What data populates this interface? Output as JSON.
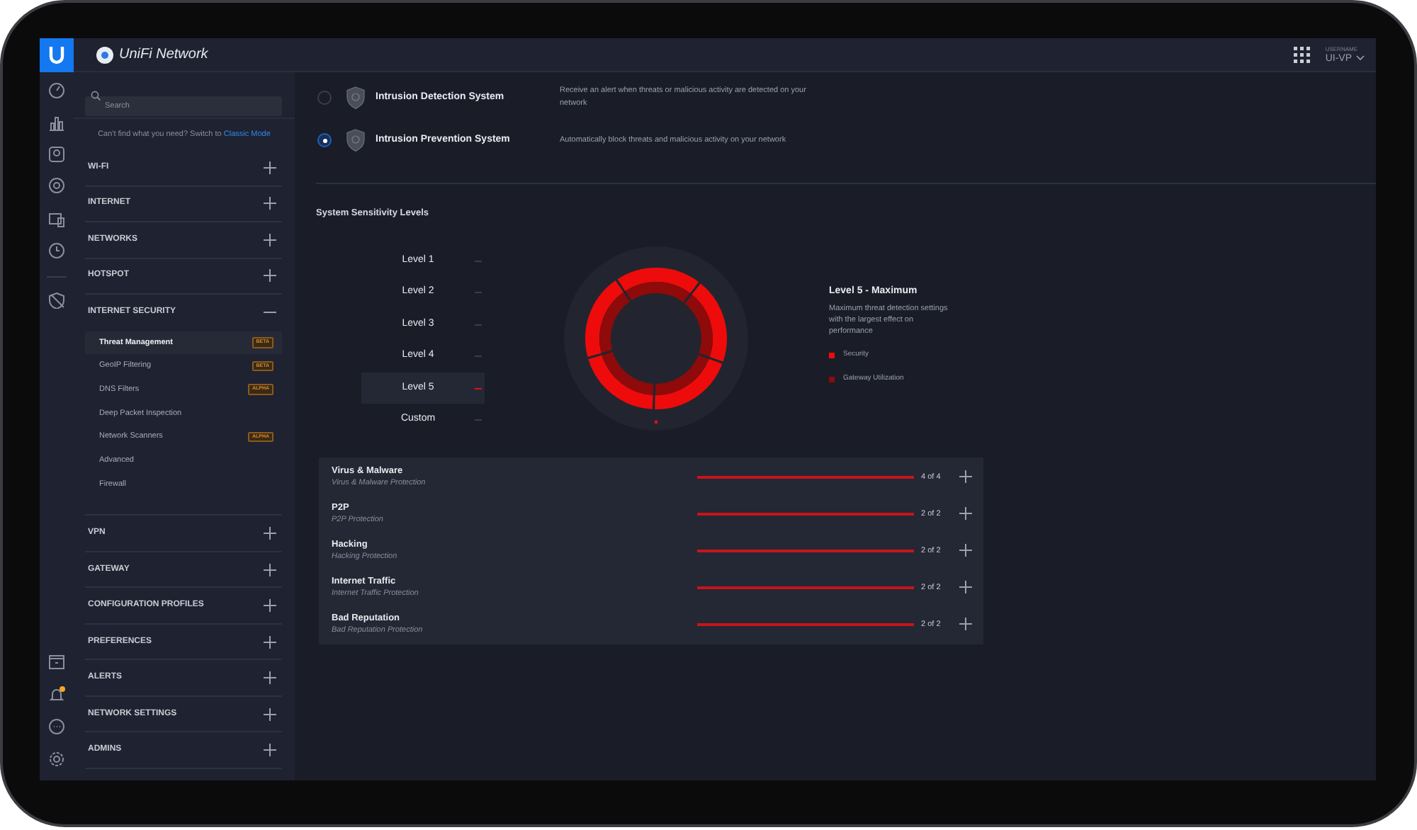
{
  "header": {
    "app_name": "UniFi Network",
    "user_label": "USERNAME",
    "user": "UI-VP"
  },
  "rail": {
    "notification": true
  },
  "sidebar": {
    "search": {
      "placeholder": "Search"
    },
    "hint": "Can't find what you need? Switch to",
    "hint_link": "Classic Mode",
    "sections": [
      {
        "label": "WI-FI",
        "expanded": false
      },
      {
        "label": "INTERNET",
        "expanded": false
      },
      {
        "label": "NETWORKS",
        "expanded": false
      },
      {
        "label": "HOTSPOT",
        "expanded": false
      },
      {
        "label": "INTERNET SECURITY",
        "expanded": true,
        "children": [
          {
            "label": "Threat Management",
            "selected": true,
            "badge": "BETA"
          },
          {
            "label": "GeoIP Filtering",
            "selected": false,
            "badge": "BETA"
          },
          {
            "label": "DNS Filters",
            "selected": false,
            "badge": "ALPHA"
          },
          {
            "label": "Deep Packet Inspection",
            "selected": false
          },
          {
            "label": "Network Scanners",
            "selected": false,
            "badge": "ALPHA"
          },
          {
            "label": "Advanced",
            "selected": false
          },
          {
            "label": "Firewall",
            "selected": false
          }
        ]
      },
      {
        "label": "VPN",
        "expanded": false
      },
      {
        "label": "GATEWAY",
        "expanded": false
      },
      {
        "label": "CONFIGURATION PROFILES",
        "expanded": false
      },
      {
        "label": "PREFERENCES",
        "expanded": false
      },
      {
        "label": "ALERTS",
        "expanded": false
      },
      {
        "label": "NETWORK SETTINGS",
        "expanded": false
      },
      {
        "label": "ADMINS",
        "expanded": false
      }
    ]
  },
  "systems": [
    {
      "label": "Intrusion Detection System",
      "description": "Receive an alert when threats or malicious activity are detected on your network",
      "selected": false
    },
    {
      "label": "Intrusion Prevention System",
      "description": "Automatically block threats and malicious activity on your network",
      "selected": true
    }
  ],
  "sensitivity": {
    "title": "System Sensitivity Levels",
    "levels": [
      {
        "label": "Level 1",
        "selected": false
      },
      {
        "label": "Level 2",
        "selected": false
      },
      {
        "label": "Level 3",
        "selected": false
      },
      {
        "label": "Level 4",
        "selected": false
      },
      {
        "label": "Level 5",
        "selected": true
      },
      {
        "label": "Custom",
        "selected": false
      }
    ],
    "detail_title": "Level 5 - Maximum",
    "detail_text": "Maximum threat detection settings with the largest effect on performance",
    "legend": [
      {
        "label": "Security",
        "color": "#ee0b0b"
      },
      {
        "label": "Gateway Utilization",
        "color": "#8f0a0a"
      }
    ]
  },
  "categories": [
    {
      "name": "Virus & Malware",
      "subtitle": "Virus & Malware Protection",
      "level": 1,
      "reading": "4 of 4"
    },
    {
      "name": "P2P",
      "subtitle": "P2P Protection",
      "level": 1,
      "reading": "2 of 2"
    },
    {
      "name": "Hacking",
      "subtitle": "Hacking Protection",
      "level": 1,
      "reading": "2 of 2"
    },
    {
      "name": "Internet Traffic",
      "subtitle": "Internet Traffic Protection",
      "level": 1,
      "reading": "2 of 2"
    },
    {
      "name": "Bad Reputation",
      "subtitle": "Bad Reputation Protection",
      "level": 1,
      "reading": "2 of 2"
    }
  ]
}
